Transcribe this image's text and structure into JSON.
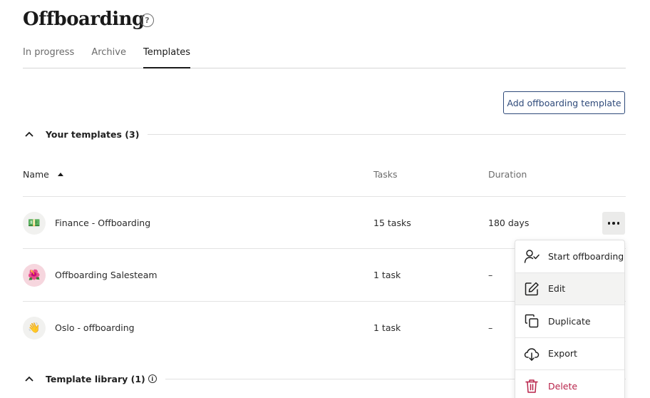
{
  "page": {
    "title": "Offboarding",
    "help_icon": "question-circle-icon"
  },
  "tabs": [
    {
      "label": "In progress",
      "active": false
    },
    {
      "label": "Archive",
      "active": false
    },
    {
      "label": "Templates",
      "active": true
    }
  ],
  "add_button_label": "Add offboarding template",
  "your_templates": {
    "label": "Your templates (3)",
    "columns": {
      "name": "Name",
      "tasks": "Tasks",
      "duration": "Duration"
    },
    "rows": [
      {
        "emoji": "💵",
        "name": "Finance - Offboarding",
        "tasks": "15 tasks",
        "duration": "180 days"
      },
      {
        "emoji": "🌺",
        "name": "Offboarding Salesteam",
        "tasks": "1 task",
        "duration": "–"
      },
      {
        "emoji": "👋",
        "name": "Oslo - offboarding",
        "tasks": "1 task",
        "duration": "–"
      }
    ]
  },
  "template_library": {
    "label": "Template library (1)"
  },
  "context_menu": {
    "items": [
      {
        "label": "Start offboarding",
        "icon": "user-check-icon"
      },
      {
        "label": "Edit",
        "icon": "edit-icon"
      },
      {
        "label": "Duplicate",
        "icon": "duplicate-icon"
      },
      {
        "label": "Export",
        "icon": "download-cloud-icon"
      },
      {
        "label": "Delete",
        "icon": "trash-icon",
        "color": "#b8234a"
      }
    ]
  }
}
